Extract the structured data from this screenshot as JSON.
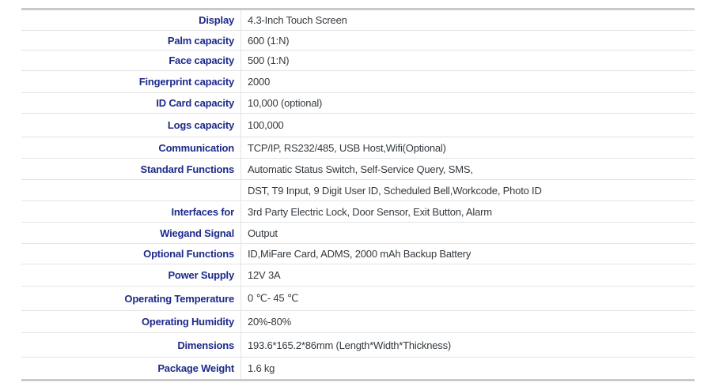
{
  "specs": [
    {
      "label": "Display",
      "value": "4.3-Inch Touch Screen",
      "h": 25
    },
    {
      "label": "Palm capacity",
      "value": "600 (1:N)",
      "h": 25
    },
    {
      "label": "Face capacity",
      "value": "500 (1:N)",
      "h": 26
    },
    {
      "label": "Fingerprint capacity",
      "value": "2000",
      "h": 28
    },
    {
      "label": "ID Card capacity",
      "value": "10,000 (optional)",
      "h": 26
    },
    {
      "label": "Logs capacity",
      "value": "100,000",
      "h": 30
    },
    {
      "label": "Communication",
      "value": "TCP/IP, RS232/485, USB Host,Wifi(Optional)",
      "h": 27
    },
    {
      "label": "Standard Functions",
      "value": "Automatic Status Switch, Self-Service Query,  SMS,",
      "h": 27
    },
    {
      "label": "",
      "value": "DST, T9 Input, 9 Digit User ID, Scheduled Bell,Workcode, Photo ID",
      "h": 27
    },
    {
      "label": "Interfaces for",
      "value": "3rd Party Electric Lock, Door Sensor, Exit Button, Alarm",
      "h": 27
    },
    {
      "label": "Wiegand Signal",
      "value": "Output",
      "h": 27
    },
    {
      "label": "Optional Functions",
      "value": "ID,MiFare Card, ADMS, 2000 mAh Backup Battery",
      "h": 26
    },
    {
      "label": "Power Supply",
      "value": "12V 3A",
      "h": 28
    },
    {
      "label": "Operating Temperature",
      "value": "0 ℃- 45 ℃",
      "h": 31
    },
    {
      "label": "Operating Humidity",
      "value": "20%-80%",
      "h": 28
    },
    {
      "label": "Dimensions",
      "value": "193.6*165.2*86mm (Length*Width*Thickness)",
      "h": 31
    },
    {
      "label": "Package Weight",
      "value": "1.6 kg",
      "h": 28
    }
  ]
}
